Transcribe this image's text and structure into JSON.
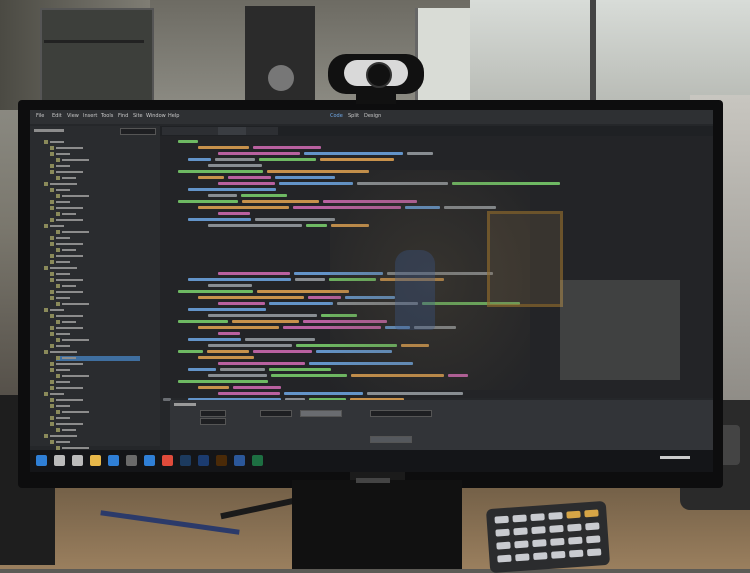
{
  "scene": {
    "description_kind": "photo",
    "colors": {
      "screen_bg": "#25272a",
      "code_green": "#7bd36e",
      "code_orange": "#e4a552",
      "code_pink": "#d46cb6",
      "code_blue": "#6fa8e6",
      "code_grey": "#9aa0a6",
      "selection_blue": "#3f6fa0"
    }
  },
  "screen": {
    "menu": [
      "File",
      "Edit",
      "View",
      "Insert",
      "Tools",
      "Find",
      "Site",
      "Window",
      "Help"
    ],
    "workspace_modes": [
      "Code",
      "Split",
      "Design"
    ]
  },
  "taskbar": {
    "icons": [
      "windows-icon",
      "search-icon",
      "taskview-icon",
      "file-explorer-icon",
      "edge-icon",
      "store-icon",
      "mail-icon",
      "chrome-icon",
      "dreamweaver-icon",
      "photoshop-icon",
      "illustrator-icon",
      "word-icon",
      "excel-icon"
    ]
  }
}
